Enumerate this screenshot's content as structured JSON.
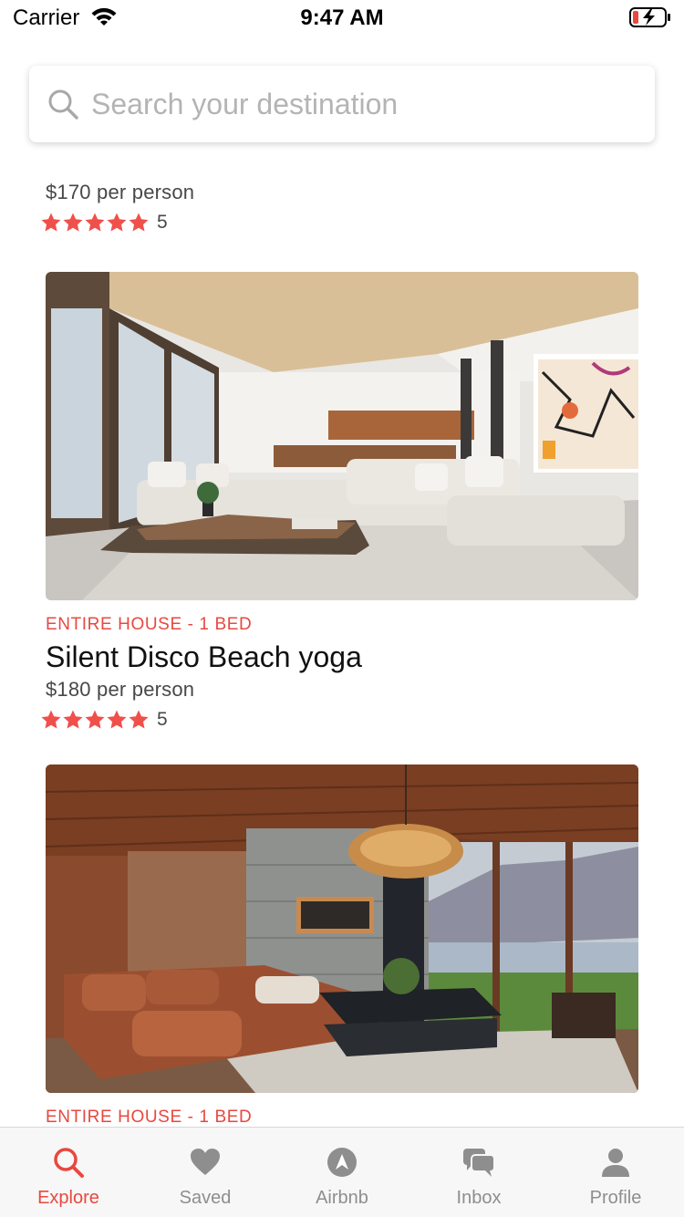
{
  "status_bar": {
    "carrier": "Carrier",
    "time": "9:47 AM"
  },
  "search": {
    "placeholder": "Search your destination"
  },
  "listings": [
    {
      "price": "$170 per person",
      "rating_count": "5",
      "stars": 5
    },
    {
      "type": "ENTIRE HOUSE - 1 BED",
      "title": "Silent Disco Beach yoga",
      "price": "$180 per person",
      "rating_count": "5",
      "stars": 5
    },
    {
      "type": "ENTIRE HOUSE - 1 BED"
    }
  ],
  "tabs": [
    {
      "label": "Explore",
      "icon": "search-icon",
      "active": true
    },
    {
      "label": "Saved",
      "icon": "heart-icon",
      "active": false
    },
    {
      "label": "Airbnb",
      "icon": "airbnb-icon",
      "active": false
    },
    {
      "label": "Inbox",
      "icon": "chat-icon",
      "active": false
    },
    {
      "label": "Profile",
      "icon": "user-icon",
      "active": false
    }
  ],
  "colors": {
    "accent": "#e8483f",
    "star": "#f0504b",
    "inactive": "#8e8e8e"
  }
}
